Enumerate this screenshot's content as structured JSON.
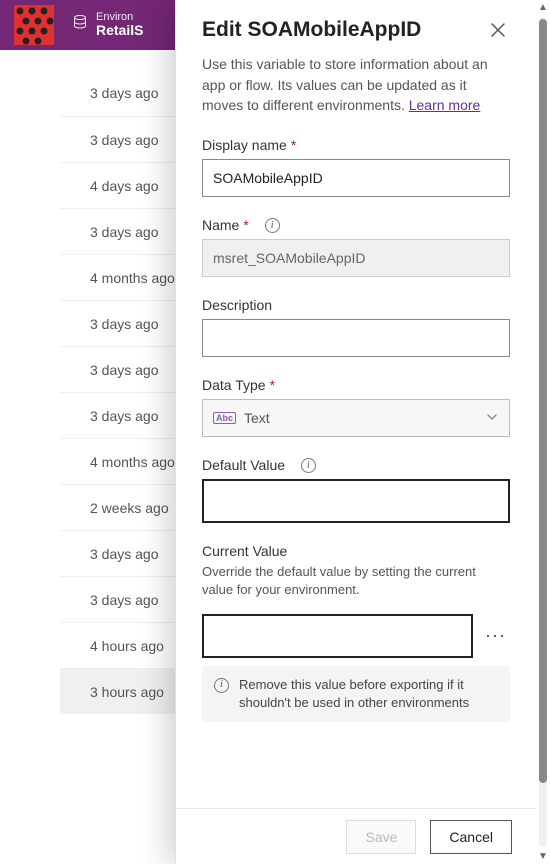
{
  "header": {
    "env_label": "Environ",
    "env_name": "RetailS"
  },
  "list": {
    "rows": [
      {
        "age": "3 days ago"
      },
      {
        "age": "3 days ago"
      },
      {
        "age": "4 days ago"
      },
      {
        "age": "3 days ago"
      },
      {
        "age": "4 months ago"
      },
      {
        "age": "3 days ago"
      },
      {
        "age": "3 days ago"
      },
      {
        "age": "3 days ago"
      },
      {
        "age": "4 months ago"
      },
      {
        "age": "2 weeks ago"
      },
      {
        "age": "3 days ago"
      },
      {
        "age": "3 days ago"
      },
      {
        "age": "4 hours ago"
      },
      {
        "age": "3 hours ago"
      }
    ]
  },
  "panel": {
    "title": "Edit SOAMobileAppID",
    "description_prefix": "Use this variable to store information about an app or flow. Its values can be updated as it moves to different environments. ",
    "learn_more": "Learn more",
    "labels": {
      "display_name": "Display name",
      "name": "Name",
      "description": "Description",
      "data_type": "Data Type",
      "default_value": "Default Value",
      "current_value": "Current Value"
    },
    "fields": {
      "display_name": "SOAMobileAppID",
      "name": "msret_SOAMobileAppID",
      "description": "",
      "data_type_badge": "Abc",
      "data_type": "Text",
      "default_value": "",
      "current_value": ""
    },
    "current_value_hint": "Override the default value by setting the current value for your environment.",
    "warning": "Remove this value before exporting if it shouldn't be used in other environments",
    "buttons": {
      "save": "Save",
      "cancel": "Cancel"
    }
  }
}
